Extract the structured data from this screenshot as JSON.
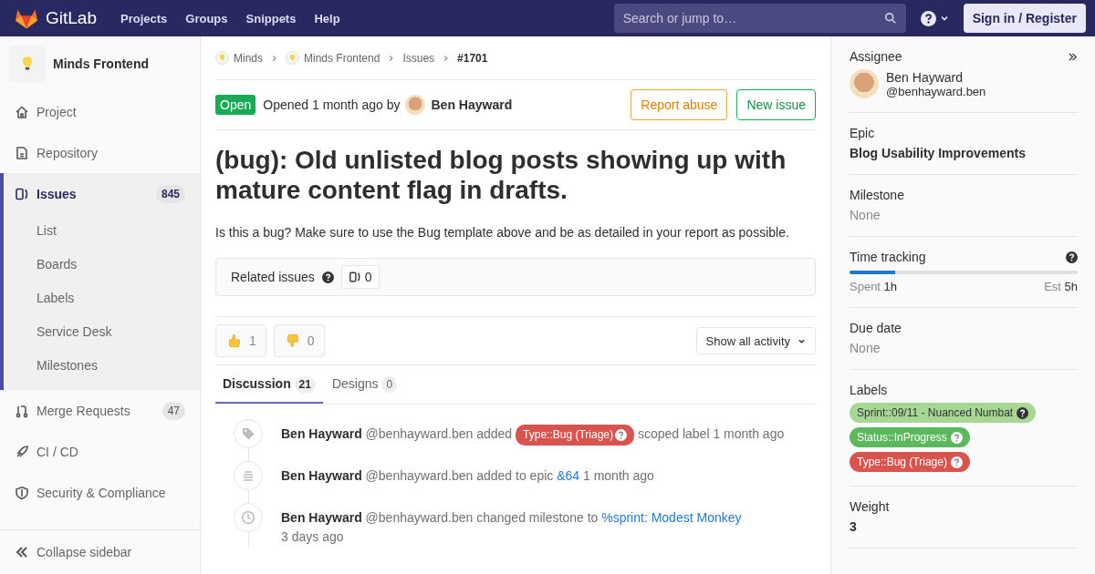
{
  "header": {
    "logo": "GitLab",
    "nav": [
      "Projects",
      "Groups",
      "Snippets",
      "Help"
    ],
    "search": {
      "placeholder": "Search or jump to…"
    },
    "sign_in": "Sign in / Register"
  },
  "sidebar": {
    "project": "Minds Frontend",
    "items": [
      {
        "label": "Project",
        "selected": false
      },
      {
        "label": "Repository",
        "selected": false
      },
      {
        "label": "Issues",
        "count": "845",
        "selected": true,
        "children": [
          {
            "label": "List"
          },
          {
            "label": "Boards"
          },
          {
            "label": "Labels"
          },
          {
            "label": "Service Desk"
          },
          {
            "label": "Milestones"
          }
        ]
      },
      {
        "label": "Merge Requests",
        "count": "47",
        "selected": false
      },
      {
        "label": "CI / CD",
        "selected": false
      },
      {
        "label": "Security & Compliance",
        "selected": false
      }
    ],
    "collapse": "Collapse sidebar"
  },
  "breadcrumbs": [
    {
      "label": "Minds",
      "kind": "project"
    },
    {
      "label": "Minds Frontend",
      "kind": "project"
    },
    {
      "label": "Issues",
      "kind": "plain"
    },
    {
      "label": "#1701",
      "kind": "current"
    }
  ],
  "issue": {
    "status": "Open",
    "opened": "Opened 1 month ago by",
    "author": "Ben Hayward",
    "buttons": [
      {
        "label": "Report abuse",
        "kind": "warning"
      },
      {
        "label": "New issue",
        "kind": "success"
      }
    ],
    "title": "(bug): Old unlisted blog posts showing up with mature content flag in drafts.",
    "description": "Is this a bug? Make sure to use the Bug template above and be as detailed in your report as possible.",
    "related": {
      "label": "Related issues",
      "count": "0"
    },
    "awards": [
      {
        "kind": "thumbsup",
        "count": "1"
      },
      {
        "kind": "thumbsdown",
        "count": "0"
      }
    ],
    "activity_filter": "Show all activity",
    "tabs": [
      {
        "label": "Discussion",
        "count": "21",
        "selected": true
      },
      {
        "label": "Designs",
        "count": "0",
        "selected": false
      }
    ],
    "notes": [
      {
        "author": "Ben Hayward",
        "parts": [
          {
            "kind": "text",
            "text": "@benhayward.ben added"
          },
          {
            "kind": "label",
            "text": "Type::Bug (Triage)",
            "color": "#d9534f"
          },
          {
            "kind": "text",
            "text": "scoped label 1 month ago"
          }
        ]
      },
      {
        "author": "Ben Hayward",
        "parts": [
          {
            "kind": "text",
            "text": "@benhayward.ben added to epic"
          },
          {
            "kind": "link",
            "text": "&64"
          },
          {
            "kind": "text",
            "text": "1 month ago"
          }
        ]
      },
      {
        "author": "Ben Hayward",
        "parts": [
          {
            "kind": "text",
            "text": "@benhayward.ben changed milestone to"
          },
          {
            "kind": "link",
            "text": "%sprint: Modest Monkey"
          },
          {
            "kind": "text",
            "text": "3 days ago"
          }
        ]
      }
    ]
  },
  "right_sidebar": {
    "assignee": {
      "title": "Assignee",
      "name": "Ben Hayward",
      "handle": "@benhayward.ben"
    },
    "epic": {
      "title": "Epic",
      "value": "Blog Usability Improvements"
    },
    "milestone": {
      "title": "Milestone",
      "value": "None"
    },
    "time_tracking": {
      "title": "Time tracking",
      "level": 0.2,
      "spent_label": "Spent",
      "spent": "1h",
      "est_label": "Est",
      "est": "5h"
    },
    "due_date": {
      "title": "Due date",
      "value": "None"
    },
    "labels": {
      "title": "Labels",
      "items": [
        {
          "text": "Sprint::09/11 - Nuanced Numbat",
          "color": "#a8d695",
          "dark_text": true
        },
        {
          "text": "Status::InProgress",
          "color": "#5cb85c",
          "dark_text": false
        },
        {
          "text": "Type::Bug (Triage)",
          "color": "#d9534f",
          "dark_text": false
        }
      ]
    },
    "weight": {
      "title": "Weight",
      "value": "3"
    }
  }
}
